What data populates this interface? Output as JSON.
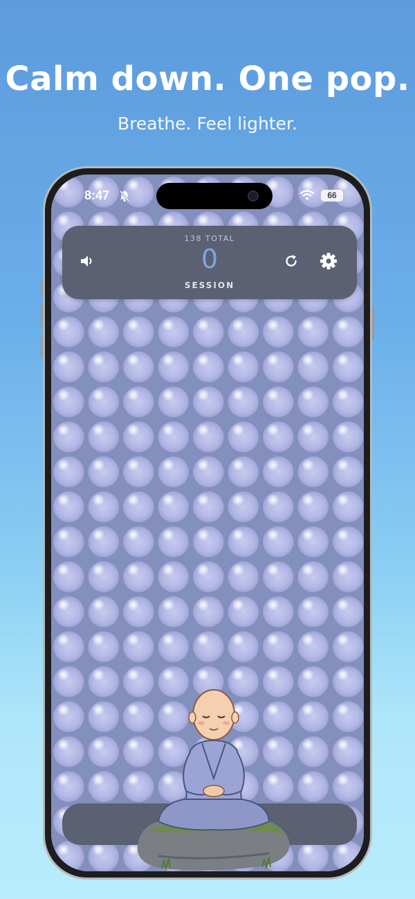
{
  "promo": {
    "headline": "Calm down. One pop.",
    "subline": "Breathe. Feel lighter."
  },
  "status_bar": {
    "time": "8:47",
    "battery": "66",
    "icons": [
      "bell-off-icon",
      "wifi-icon",
      "battery-icon"
    ]
  },
  "counter": {
    "total_label": "138 TOTAL",
    "session_count": "0",
    "session_label": "SESSION"
  },
  "controls": {
    "sound_icon": "speaker-icon",
    "reset_icon": "refresh-icon",
    "settings_icon": "gear-icon"
  },
  "colors": {
    "background_top": "#5d9bdc",
    "background_bottom": "#b8ecfb",
    "bubble_field": "#8390bd",
    "card": "#5b6072",
    "count_accent": "#7ea6e0"
  }
}
